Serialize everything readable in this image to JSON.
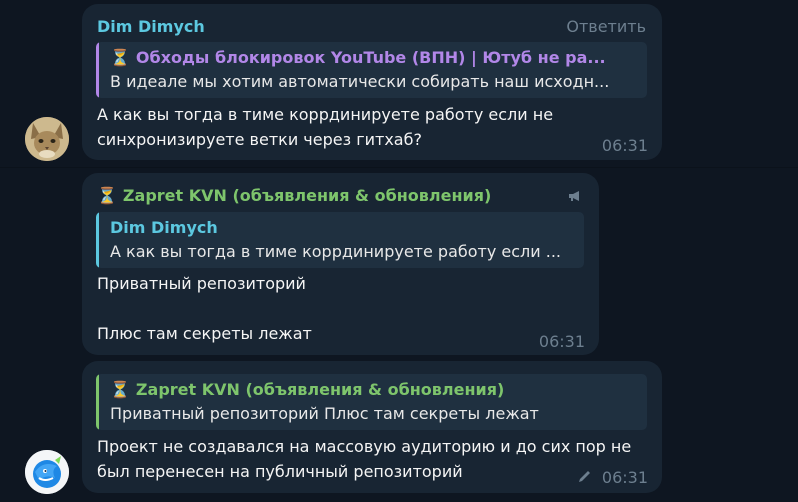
{
  "colors": {
    "background": "#0e1621",
    "bubble": "#182533",
    "quote_bg": "#1f3040",
    "name_cyan": "#5cc8e0",
    "name_purple": "#b287e8",
    "name_green": "#7ec56c",
    "meta": "#6d7f8f"
  },
  "messages": [
    {
      "sender": "Dim Dimych",
      "reply_action": "Ответить",
      "quote": {
        "icon": "hourglass-icon",
        "title": "Обходы блокировок YouTube (ВПН) | Ютуб не ра...",
        "text": "В идеале мы хотим автоматически собирать наш исходн..."
      },
      "lines": [
        "А как вы тогда в тиме коррдинируете работу если не",
        "синхронизируете ветки через гитхаб?"
      ],
      "time": "06:31",
      "avatar": "cat-avatar"
    },
    {
      "sender_icon": "hourglass-icon",
      "sender": "Zapret KVN (объявления & обновления)",
      "channel_icon": "megaphone-icon",
      "quote": {
        "title": "Dim Dimych",
        "text": "А как вы тогда в тиме коррдинируете работу если ..."
      },
      "lines": [
        "Приватный репозиторий",
        "",
        "Плюс там секреты лежат"
      ],
      "time": "06:31"
    },
    {
      "quote": {
        "icon": "hourglass-icon",
        "title": "Zapret KVN (объявления & обновления)",
        "text": "Приватный репозиторий   Плюс там секреты лежат"
      },
      "lines": [
        "Проект не создавался на массовую аудиторию и до сих пор не",
        "был перенесен на публичный репозиторий"
      ],
      "edited_icon": "pencil-icon",
      "time": "06:31",
      "avatar": "dolphin-avatar"
    }
  ]
}
